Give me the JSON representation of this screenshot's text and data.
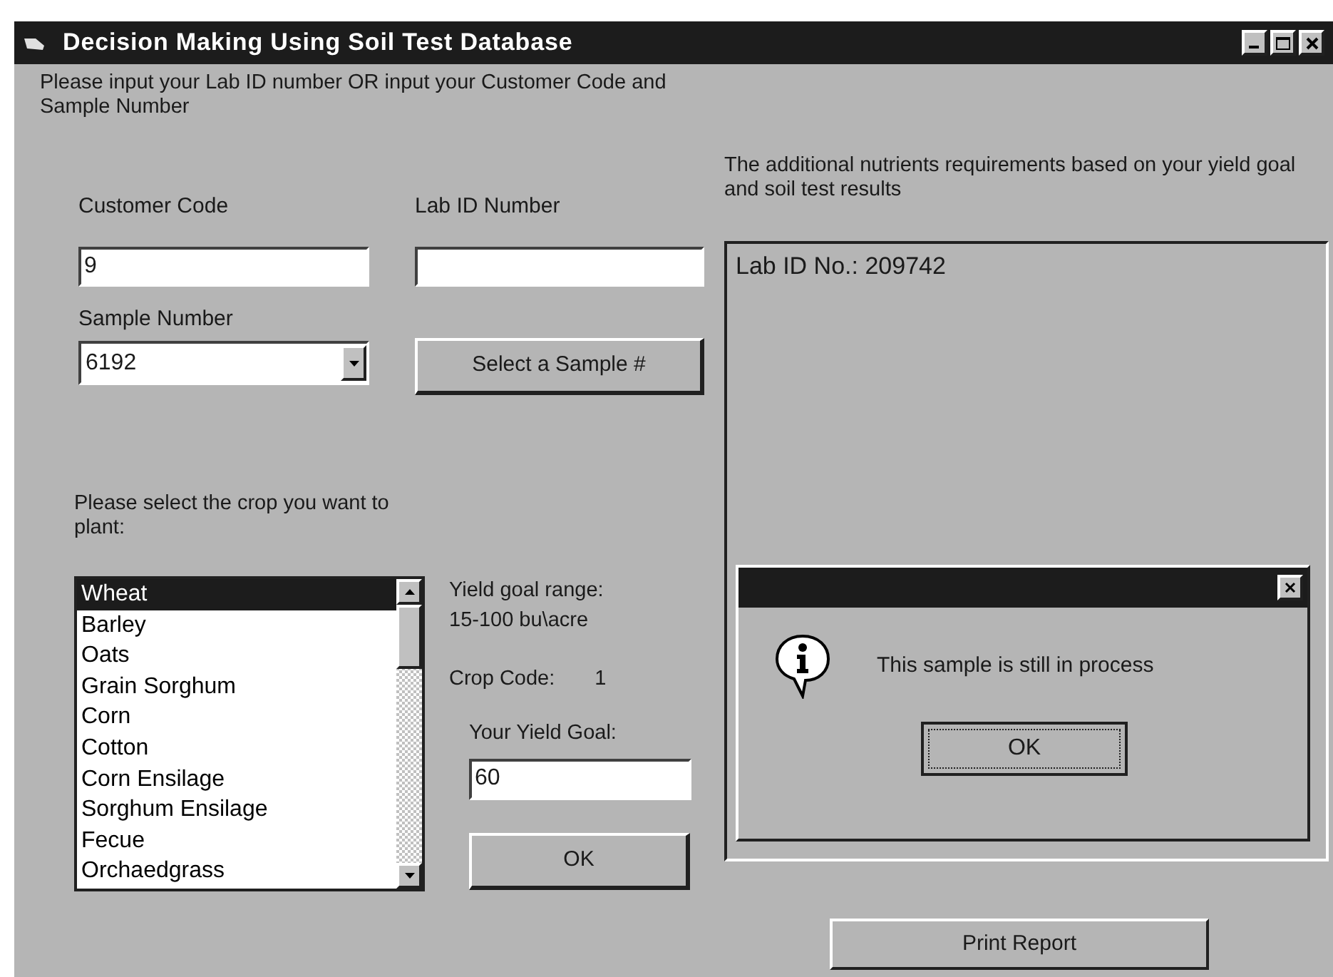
{
  "window": {
    "title": "Decision Making Using Soil Test Database"
  },
  "instructions": "Please input your Lab ID number OR input your Customer Code and Sample Number",
  "customer_code": {
    "label": "Customer Code",
    "value": "9"
  },
  "lab_id": {
    "label": "Lab ID Number"
  },
  "sample_number": {
    "label": "Sample Number",
    "value": "6192"
  },
  "select_button": "Select a Sample  #",
  "crop_prompt": "Please select the  crop you want to plant:",
  "crops": [
    {
      "label": "Wheat",
      "selected": true
    },
    {
      "label": "Barley",
      "selected": false
    },
    {
      "label": "Oats",
      "selected": false
    },
    {
      "label": "Grain Sorghum",
      "selected": false
    },
    {
      "label": "Corn",
      "selected": false
    },
    {
      "label": "Cotton",
      "selected": false
    },
    {
      "label": "Corn Ensilage",
      "selected": false
    },
    {
      "label": "Sorghum Ensilage",
      "selected": false
    },
    {
      "label": "Fecue",
      "selected": false
    },
    {
      "label": "Orchaedgrass",
      "selected": false
    }
  ],
  "yield_range": {
    "label": "Yield goal range:",
    "value": "15-100 bu\\acre"
  },
  "crop_code": {
    "label": "Crop Code:",
    "value": "1"
  },
  "yield_goal": {
    "label": "Your Yield Goal:",
    "value": "60"
  },
  "ok_button": "OK",
  "results": {
    "heading": "The additional nutrients requirements based on your yield goal and soil test results",
    "text": "Lab ID No.:  209742"
  },
  "dialog": {
    "message": "This sample is still in process",
    "ok_button": "OK"
  },
  "print_button": "Print Report"
}
